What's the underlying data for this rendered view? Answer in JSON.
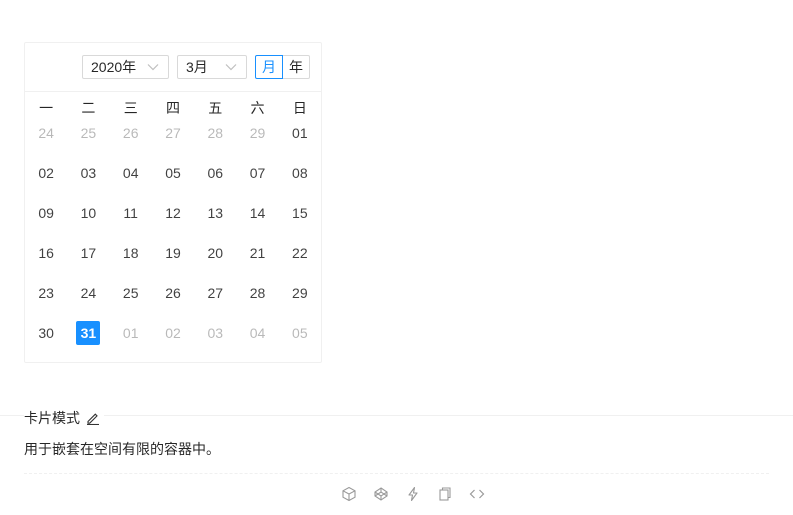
{
  "calendar": {
    "year_value": "2020年",
    "month_value": "3月",
    "mode_month_label": "月",
    "mode_year_label": "年",
    "active_mode": "月",
    "weekdays": [
      "一",
      "二",
      "三",
      "四",
      "五",
      "六",
      "日"
    ],
    "weeks": [
      [
        {
          "t": "24",
          "out": true
        },
        {
          "t": "25",
          "out": true
        },
        {
          "t": "26",
          "out": true
        },
        {
          "t": "27",
          "out": true
        },
        {
          "t": "28",
          "out": true
        },
        {
          "t": "29",
          "out": true
        },
        {
          "t": "01",
          "out": false
        }
      ],
      [
        {
          "t": "02",
          "out": false
        },
        {
          "t": "03",
          "out": false
        },
        {
          "t": "04",
          "out": false
        },
        {
          "t": "05",
          "out": false
        },
        {
          "t": "06",
          "out": false
        },
        {
          "t": "07",
          "out": false
        },
        {
          "t": "08",
          "out": false
        }
      ],
      [
        {
          "t": "09",
          "out": false
        },
        {
          "t": "10",
          "out": false
        },
        {
          "t": "11",
          "out": false
        },
        {
          "t": "12",
          "out": false
        },
        {
          "t": "13",
          "out": false
        },
        {
          "t": "14",
          "out": false
        },
        {
          "t": "15",
          "out": false
        }
      ],
      [
        {
          "t": "16",
          "out": false
        },
        {
          "t": "17",
          "out": false
        },
        {
          "t": "18",
          "out": false
        },
        {
          "t": "19",
          "out": false
        },
        {
          "t": "20",
          "out": false
        },
        {
          "t": "21",
          "out": false
        },
        {
          "t": "22",
          "out": false
        }
      ],
      [
        {
          "t": "23",
          "out": false
        },
        {
          "t": "24",
          "out": false
        },
        {
          "t": "25",
          "out": false
        },
        {
          "t": "26",
          "out": false
        },
        {
          "t": "27",
          "out": false
        },
        {
          "t": "28",
          "out": false
        },
        {
          "t": "29",
          "out": false
        }
      ],
      [
        {
          "t": "30",
          "out": false
        },
        {
          "t": "31",
          "out": false,
          "selected": true
        },
        {
          "t": "01",
          "out": true
        },
        {
          "t": "02",
          "out": true
        },
        {
          "t": "03",
          "out": true
        },
        {
          "t": "04",
          "out": true
        },
        {
          "t": "05",
          "out": true
        }
      ]
    ]
  },
  "demo": {
    "title": "卡片模式",
    "description": "用于嵌套在空间有限的容器中。"
  },
  "toolbar": {
    "icons": [
      "codesandbox-icon",
      "codepen-icon",
      "stackblitz-icon",
      "copy-icon",
      "code-expand-icon"
    ]
  },
  "colors": {
    "primary": "#1890ff",
    "border": "#d9d9d9",
    "divider": "#f0f0f0"
  }
}
